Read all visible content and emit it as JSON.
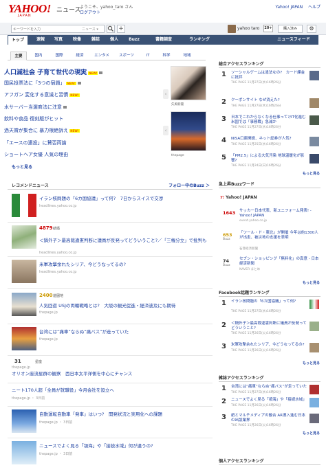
{
  "header": {
    "logo": "YAHOO!",
    "logo_sub": "JAPAN",
    "site_title": "ニュース",
    "greeting": "ようこそ、yahoo_taro さん",
    "logout": "ログアウト",
    "links": [
      "Yahoo! JAPAN",
      "ヘルプ"
    ]
  },
  "search": {
    "placeholder": "キーワードを入力",
    "scope": "ニュース",
    "add": "+",
    "user": "yahoo taro",
    "badge": "20+",
    "read_button": "購入済み",
    "gear": "⚙"
  },
  "categories": [
    "トップ",
    "速報",
    "写真",
    "映像",
    "雑誌",
    "個人",
    "Buzz",
    "書籍調査",
    "ランキング",
    "ニュースフィード"
  ],
  "subtabs": [
    "主要",
    "国内",
    "国際",
    "経済",
    "エンタメ",
    "スポーツ",
    "IT",
    "科学",
    "地域"
  ],
  "topics": [
    {
      "text": "人口減社会 子育て世代の現実",
      "flag": "NEW!",
      "cam": true
    },
    {
      "text": "国民投票法に「3つの宿題」",
      "flag": "NEW!",
      "cam": true
    },
    {
      "text": "アフガン 変化する意識と習慣",
      "flag": "NEW!",
      "cam": false
    },
    {
      "text": "水サーバー当選商法に注意",
      "flag": "",
      "cam": true
    },
    {
      "text": "飲料や食品 復刻版がヒット",
      "flag": "",
      "cam": false
    },
    {
      "text": "過天賞が集合に 暴力根絶訴え",
      "flag": "NEW!",
      "cam": false
    },
    {
      "text": "「エースの連投」に賛否両論",
      "flag": "",
      "cam": false
    },
    {
      "text": "ショートヘア女優 人気の理由",
      "flag": "",
      "cam": false
    }
  ],
  "topics_more": "もっと見る",
  "photos": [
    "矢風新聞",
    "thepage"
  ],
  "recommend": {
    "title": "レコメンドニュース",
    "follow": "フォロー中のBuzz ＞",
    "items": [
      {
        "title": "イラン核問題の「6カ国協議」って何?　7日からスイスで交渉",
        "source": "headlines.yahoo.co.jp",
        "count": "",
        "tag": ""
      },
      {
        "title": "＜鍋外子＞最高裁違憲判断に議員が反発ってどういうこと?／「三権分立」で批判も",
        "source": "headlines.yahoo.co.jp",
        "count": "4879",
        "tag": "結婚"
      },
      {
        "title": "米軍攻撃余れたシリア、今どうなってるの?",
        "source": "headlines.yahoo.co.jp",
        "count": "",
        "tag": ""
      },
      {
        "title": "人気回遊 USJの両輪戦略とは?　大阪の観光促進・経済波及にも期待",
        "source": "thepage.jp",
        "count": "2400",
        "tag": "遊園地"
      },
      {
        "title": "台湾には“痛車”ならぬ“痛バス”が走っていた",
        "source": "thepage.jp",
        "count": "",
        "tag": ""
      },
      {
        "title": "オリオン座流星群の観察　西日本太平洋側を中心にチャンス",
        "source": "thepage.jp",
        "count": "31",
        "tag": "星座"
      },
      {
        "title": "ニート170人超「全員が就職役」今月会社を設立へ",
        "source": "thepage.jp ・ 3日前",
        "count": "",
        "tag": ""
      },
      {
        "title": "自動運転自動車「発車」はいつ?　開発状況と実用化への課題",
        "source": "thepage.jp ・ 3日前",
        "count": "",
        "tag": ""
      },
      {
        "title": "ニュースでよく見る「領海」や「接続水域」何が違うの?",
        "source": "thepage.jp ・ 3日前",
        "count": "",
        "tag": ""
      }
    ]
  },
  "ranking_total": {
    "title": "総合アクセスランキング",
    "items": [
      {
        "title": "ソーシャルゲームは違法なの?　カード課金に批評",
        "source": "THE PAGE 11月27日(水)16時26分"
      },
      {
        "title": "クーポンサイト なぜ消えた?",
        "source": "THE PAGE 11月27日(木)16時26分"
      },
      {
        "title": "日本でこれからなくなる仕事って?/IT化進む米国では「事務職」急減か",
        "source": "THE PAGE 11月27日(水)16時26分"
      },
      {
        "title": "NISA口座開設、ネット証券が人気?",
        "source": "THE PAGE 11月25日(水)16時26分"
      },
      {
        "title": "「PM2.5」による大気汚染 地球温暖化が影響?",
        "source": "THE PAGE 11月24日(日)16時26分"
      }
    ],
    "more": "もっと見る"
  },
  "buzz": {
    "title": "急上昇Buzzワード",
    "brand": "Yahoo! JAPAN",
    "items": [
      {
        "count": "1643",
        "word": "",
        "title": "サッカー日本代表、新ユニフォーム発表! - Yahoo! JAPAN",
        "source": "event.yahoo.co.jp"
      },
      {
        "count": "653",
        "word": "Buzz",
        "title": "「ツール・ド・東北」が開催 今年は約1300人が出走、被災地の支援を表明",
        "source": "石巻経済新聞"
      },
      {
        "count": "74",
        "word": "Buzz",
        "title": "セブン・ショッピング「無料化」の真意 - 日本経済新聞",
        "source": "NAVER まとめ"
      }
    ],
    "more": "もっと見る"
  },
  "ranking_fb": {
    "title": "Facebook話題ランキング",
    "items": [
      {
        "title": "イラン核問題の「6カ国協議」って何?",
        "source": "THE PAGE 11月27日(水)16時26分"
      },
      {
        "title": "＜鍋外子＞最高裁違憲判断に議員が反発ってどういうこと?",
        "source": "THE PAGE 11月26日(火)16時26分"
      },
      {
        "title": "米軍攻撃余れたシリア、今どうなってるの?",
        "source": "THE PAGE 11月26日(火)16時26分"
      }
    ],
    "more": "もっと見る"
  },
  "ranking_mag": {
    "title": "雑誌アクセスランキング",
    "items": [
      {
        "title": "台湾には“痛車”ならぬ“痛バス”が走っていた",
        "source": "THE PAGE 11月27日(水)16時26分"
      },
      {
        "title": "ニュースでよく見る「領海」や「接続水域」",
        "source": "THE PAGE 11月26日(火)16時26分"
      },
      {
        "title": "紙とマルチメディアの融合 AR導入進む日本の出版業界",
        "source": "THE PAGE 11月26日(火)16時26分"
      }
    ],
    "more": "もっと見る"
  },
  "ranking_personal": {
    "title": "個人アクセスランキング"
  },
  "colors": {
    "nav": "#3a5275",
    "link": "#1b3fa0",
    "brand": "#d40000",
    "hot": "#c00000"
  }
}
